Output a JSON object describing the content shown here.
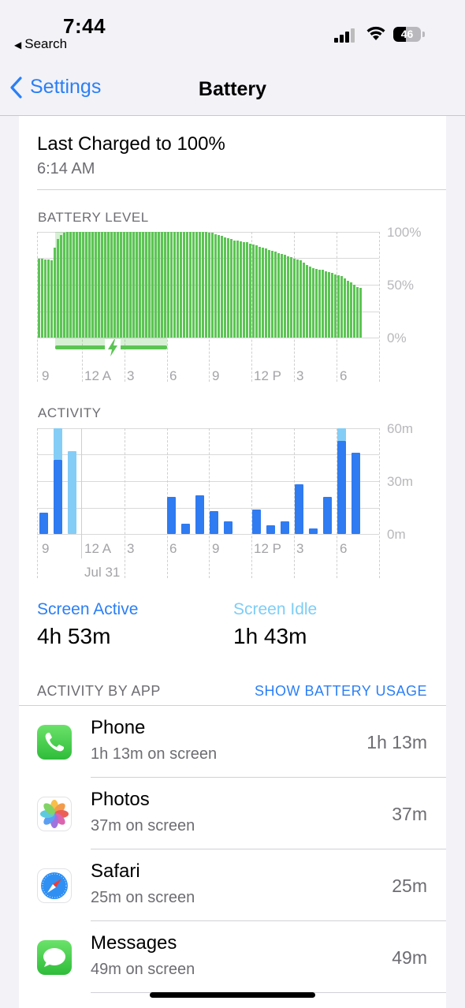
{
  "status_bar": {
    "time": "7:44",
    "back_app": "Search",
    "battery_percent": "46"
  },
  "nav": {
    "back_label": "Settings",
    "title": "Battery"
  },
  "last_charged": {
    "title": "Last Charged to 100%",
    "time": "6:14 AM"
  },
  "battery_level": {
    "label": "BATTERY LEVEL",
    "y_ticks": [
      "100%",
      "50%",
      "0%"
    ],
    "x_labels": [
      "9",
      "12 A",
      "3",
      "6",
      "9",
      "12 P",
      "3",
      "6"
    ]
  },
  "activity": {
    "label": "ACTIVITY",
    "y_ticks": [
      "60m",
      "30m",
      "0m"
    ],
    "x_labels": [
      "9",
      "12 A",
      "3",
      "6",
      "9",
      "12 P",
      "3",
      "6"
    ],
    "date_label": "Jul 31"
  },
  "summary": {
    "screen_active_label": "Screen Active",
    "screen_active_value": "4h 53m",
    "screen_idle_label": "Screen Idle",
    "screen_idle_value": "1h 43m"
  },
  "activity_by_app": {
    "label": "ACTIVITY BY APP",
    "show_usage": "SHOW BATTERY USAGE",
    "apps": [
      {
        "name": "Phone",
        "sub": "1h 13m on screen",
        "time": "1h 13m",
        "icon": "phone-icon"
      },
      {
        "name": "Photos",
        "sub": "37m on screen",
        "time": "37m",
        "icon": "photos-icon"
      },
      {
        "name": "Safari",
        "sub": "25m on screen",
        "time": "25m",
        "icon": "safari-icon"
      },
      {
        "name": "Messages",
        "sub": "49m on screen",
        "time": "49m",
        "icon": "messages-icon"
      }
    ]
  },
  "colors": {
    "accent": "#2b7ff6",
    "battery_green": "#5cc454",
    "screen_active": "#2f7bf2",
    "screen_idle": "#84cdf7"
  },
  "chart_data": [
    {
      "type": "bar",
      "title": "BATTERY LEVEL",
      "y_unit": "%",
      "ylim": [
        0,
        100
      ],
      "x_labels": [
        "9",
        "12 A",
        "3",
        "6",
        "9",
        "12 P",
        "3",
        "6"
      ],
      "series": [
        {
          "values": [
            75,
            75,
            74,
            74,
            73,
            85,
            93,
            97,
            99,
            100,
            100,
            100,
            100,
            100,
            100,
            100,
            100,
            100,
            100,
            100,
            100,
            100,
            100,
            100,
            100,
            100,
            100,
            100,
            100,
            100,
            100,
            100,
            100,
            100,
            100,
            100,
            100,
            100,
            100,
            100,
            100,
            100,
            100,
            100,
            100,
            100,
            100,
            100,
            100,
            100,
            100,
            100,
            100,
            100,
            99,
            99,
            98,
            97,
            96,
            95,
            94,
            93,
            92,
            92,
            91,
            90,
            90,
            89,
            88,
            87,
            86,
            85,
            84,
            83,
            82,
            81,
            80,
            79,
            78,
            77,
            76,
            75,
            74,
            73,
            71,
            69,
            67,
            66,
            65,
            64,
            64,
            63,
            62,
            61,
            60,
            59,
            58,
            56,
            54,
            52,
            50,
            48,
            47
          ]
        }
      ]
    },
    {
      "type": "bar",
      "title": "ACTIVITY",
      "y_unit": "minutes",
      "ylim": [
        0,
        60
      ],
      "x_labels": [
        "9",
        "12 A",
        "3",
        "6",
        "9",
        "12 P",
        "3",
        "6"
      ],
      "series": [
        {
          "name": "Screen Active",
          "values": [
            12,
            42,
            0,
            0,
            0,
            0,
            0,
            0,
            0,
            21,
            6,
            22,
            13,
            7,
            0,
            14,
            5,
            7,
            28,
            3,
            21,
            53,
            46
          ]
        },
        {
          "name": "Screen Idle",
          "values": [
            0,
            18,
            47,
            0,
            0,
            0,
            0,
            0,
            0,
            0,
            0,
            0,
            0,
            0,
            0,
            0,
            0,
            0,
            0,
            0,
            0,
            7,
            0
          ]
        }
      ]
    }
  ]
}
